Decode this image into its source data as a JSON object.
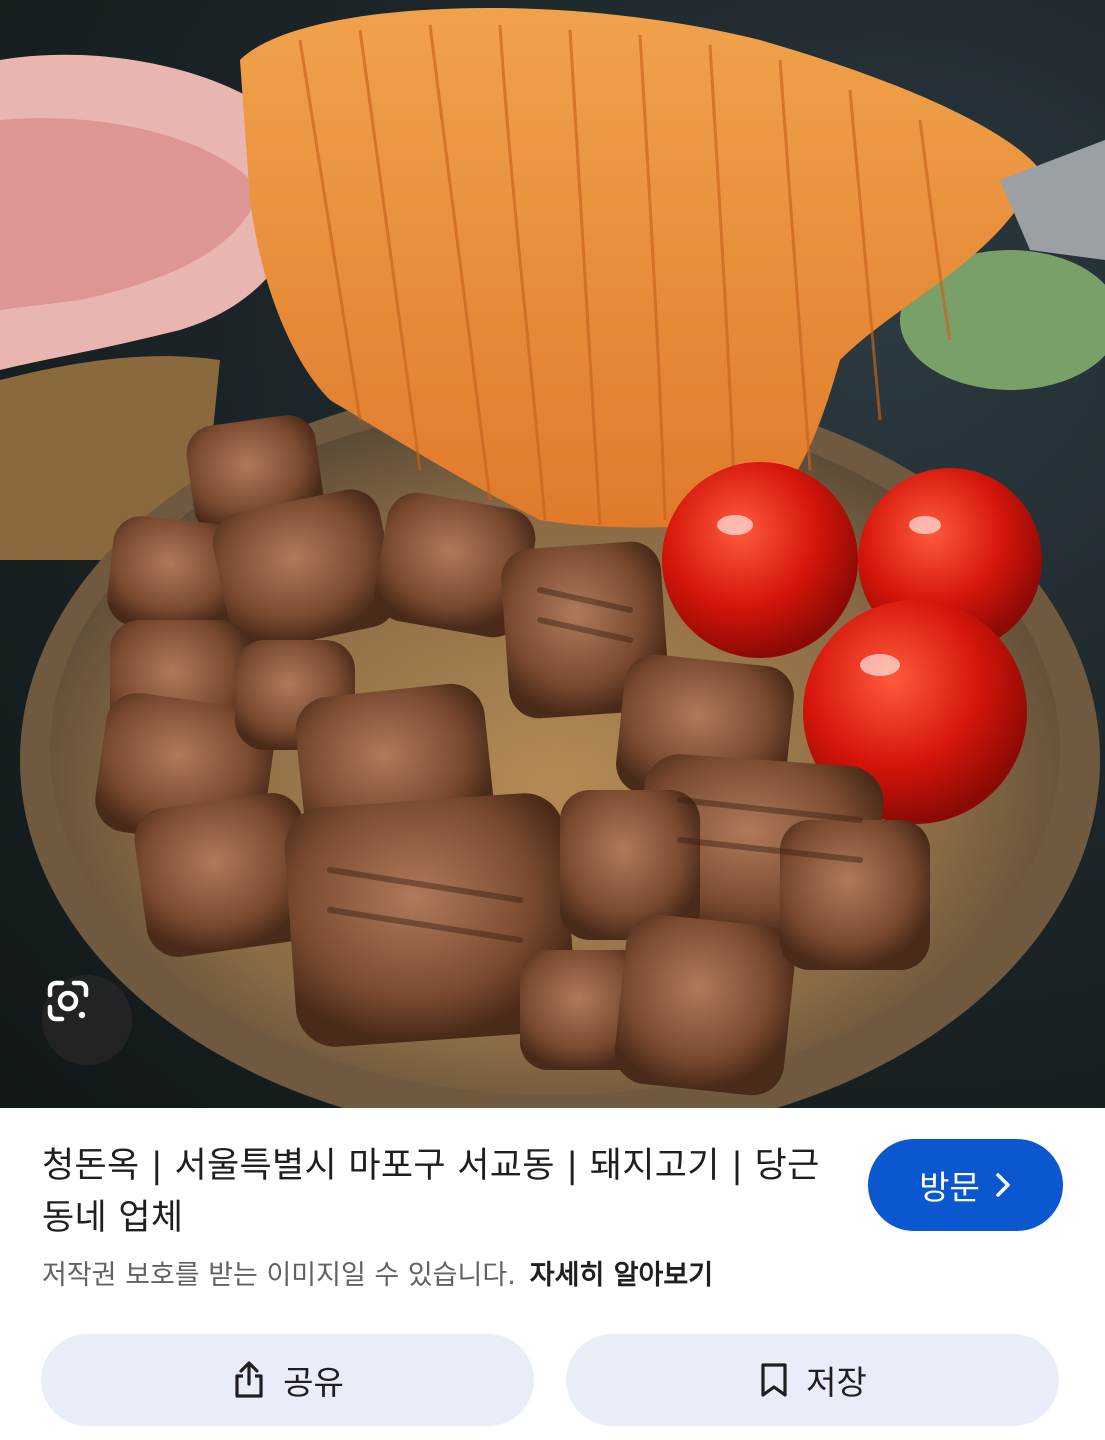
{
  "image": {
    "alt": "",
    "lens_icon": "google-lens-camera-icon"
  },
  "result": {
    "title": "청돈옥 | 서울특별시 마포구 서교동 | 돼지고기 | 당근 동네 업체",
    "visit_label": "방문",
    "visit_icon": "chevron-right-icon",
    "copyright_notice": "저작권 보호를 받는 이미지일 수 있습니다.",
    "learn_more_label": "자세히 알아보기"
  },
  "actions": {
    "share_label": "공유",
    "share_icon": "share-icon",
    "save_label": "저장",
    "save_icon": "bookmark-icon"
  },
  "colors": {
    "accent": "#0b57d0",
    "action_bg": "#e8edf8",
    "text": "#1f1f1f",
    "muted": "#5f6368"
  }
}
